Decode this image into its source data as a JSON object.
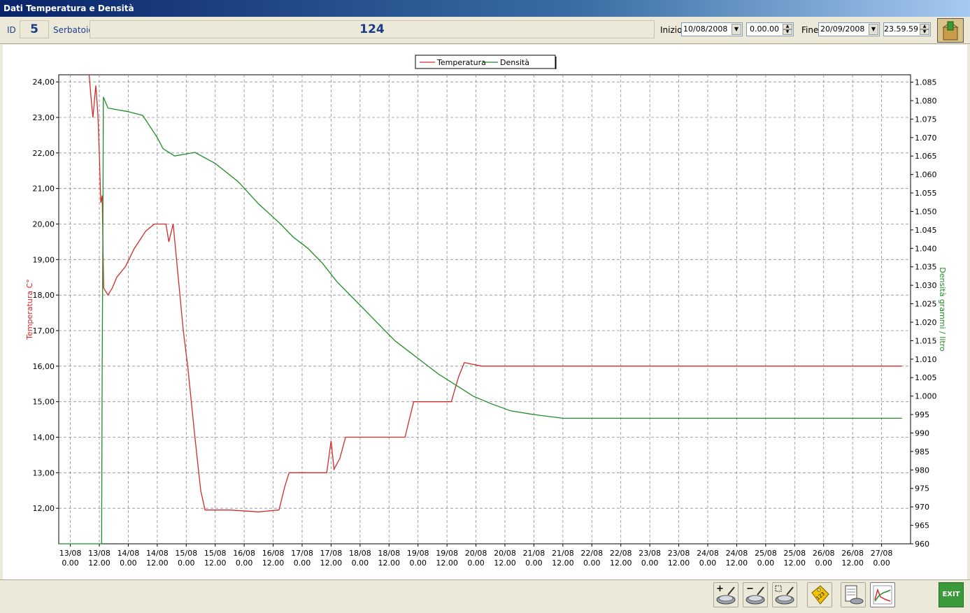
{
  "window": {
    "title": "Dati Temperatura e Densità"
  },
  "header": {
    "id_label": "ID",
    "id_value": "5",
    "tank_label": "Serbatoio",
    "tank_value": "124",
    "start_label": "Inizio",
    "start_date": "10/08/2008",
    "start_time": "0.00.00",
    "end_label": "Fine",
    "end_date": "20/09/2008",
    "end_time": "23.59.59"
  },
  "toolbar_icons": [
    "export-icon"
  ],
  "bottom_buttons": [
    {
      "name": "zoom-in-button",
      "icon": "zoom-in-icon"
    },
    {
      "name": "zoom-out-button",
      "icon": "zoom-out-icon"
    },
    {
      "name": "zoom-reset-button",
      "icon": "zoom-reset-icon"
    },
    {
      "name": "labels-button",
      "icon": "tag-icon"
    },
    {
      "name": "print-button",
      "icon": "print-icon"
    },
    {
      "name": "chart-button",
      "icon": "chart-icon"
    }
  ],
  "exit_label": "EXIT",
  "colors": {
    "temperature": "#d42a2a",
    "density": "#1e8c28",
    "grid": "#8c8c8c",
    "accent": "#1c3a8c"
  },
  "chart_data": {
    "type": "line",
    "title": "",
    "legend": [
      "Temperatura",
      "Densità"
    ],
    "legend_position": "top-center",
    "grid": true,
    "x_ticks": [
      {
        "date": "13/08",
        "time": "0.00"
      },
      {
        "date": "13/08",
        "time": "12.00"
      },
      {
        "date": "14/08",
        "time": "0.00"
      },
      {
        "date": "14/08",
        "time": "12.00"
      },
      {
        "date": "15/08",
        "time": "0.00"
      },
      {
        "date": "15/08",
        "time": "12.00"
      },
      {
        "date": "16/08",
        "time": "0.00"
      },
      {
        "date": "16/08",
        "time": "12.00"
      },
      {
        "date": "17/08",
        "time": "0.00"
      },
      {
        "date": "17/08",
        "time": "12.00"
      },
      {
        "date": "18/08",
        "time": "0.00"
      },
      {
        "date": "18/08",
        "time": "12.00"
      },
      {
        "date": "19/08",
        "time": "0.00"
      },
      {
        "date": "19/08",
        "time": "12.00"
      },
      {
        "date": "20/08",
        "time": "0.00"
      },
      {
        "date": "20/08",
        "time": "12.00"
      },
      {
        "date": "21/08",
        "time": "0.00"
      },
      {
        "date": "21/08",
        "time": "12.00"
      },
      {
        "date": "22/08",
        "time": "0.00"
      },
      {
        "date": "22/08",
        "time": "12.00"
      },
      {
        "date": "23/08",
        "time": "0.00"
      },
      {
        "date": "23/08",
        "time": "12.00"
      },
      {
        "date": "24/08",
        "time": "0.00"
      },
      {
        "date": "24/08",
        "time": "12.00"
      },
      {
        "date": "25/08",
        "time": "0.00"
      },
      {
        "date": "25/08",
        "time": "12.00"
      },
      {
        "date": "26/08",
        "time": "0.00"
      },
      {
        "date": "26/08",
        "time": "12.00"
      },
      {
        "date": "27/08",
        "time": "0.00"
      }
    ],
    "xlim": [
      -0.4,
      29.0
    ],
    "y_left": {
      "label": "Temperatura C°",
      "lim": [
        11.0,
        24.2
      ],
      "ticks": [
        "12,00",
        "13,00",
        "14,00",
        "15,00",
        "16,00",
        "17,00",
        "18,00",
        "19,00",
        "20,00",
        "21,00",
        "22,00",
        "23,00",
        "24,00"
      ]
    },
    "y_right": {
      "label": "Densità grammi / litro",
      "lim": [
        960,
        1087
      ],
      "ticks": [
        "960",
        "965",
        "970",
        "975",
        "980",
        "985",
        "990",
        "995",
        "1.000",
        "1.005",
        "1.010",
        "1.015",
        "1.020",
        "1.025",
        "1.030",
        "1.035",
        "1.040",
        "1.045",
        "1.050",
        "1.055",
        "1.060",
        "1.065",
        "1.070",
        "1.075",
        "1.080",
        "1.085"
      ]
    },
    "series": [
      {
        "name": "Temperatura",
        "axis": "left",
        "points": [
          [
            0.65,
            24.2
          ],
          [
            0.72,
            23.5
          ],
          [
            0.78,
            23.0
          ],
          [
            0.88,
            23.9
          ],
          [
            0.95,
            23.1
          ],
          [
            1.0,
            22.0
          ],
          [
            1.05,
            20.6
          ],
          [
            1.1,
            20.8
          ],
          [
            1.15,
            18.2
          ],
          [
            1.3,
            18.0
          ],
          [
            1.45,
            18.2
          ],
          [
            1.6,
            18.5
          ],
          [
            1.9,
            18.8
          ],
          [
            2.2,
            19.3
          ],
          [
            2.6,
            19.8
          ],
          [
            2.9,
            20.0
          ],
          [
            3.3,
            20.0
          ],
          [
            3.4,
            19.5
          ],
          [
            3.55,
            20.0
          ],
          [
            3.9,
            17.0
          ],
          [
            4.05,
            16.0
          ],
          [
            4.3,
            14.0
          ],
          [
            4.5,
            12.5
          ],
          [
            4.65,
            11.95
          ],
          [
            5.5,
            11.95
          ],
          [
            6.5,
            11.9
          ],
          [
            7.2,
            11.95
          ],
          [
            7.4,
            12.6
          ],
          [
            7.55,
            13.0
          ],
          [
            8.5,
            13.0
          ],
          [
            8.85,
            13.0
          ],
          [
            9.0,
            13.9
          ],
          [
            9.1,
            13.1
          ],
          [
            9.3,
            13.4
          ],
          [
            9.5,
            14.0
          ],
          [
            10.5,
            14.0
          ],
          [
            11.55,
            14.0
          ],
          [
            11.85,
            15.0
          ],
          [
            12.5,
            15.0
          ],
          [
            13.15,
            15.0
          ],
          [
            13.4,
            15.7
          ],
          [
            13.6,
            16.1
          ],
          [
            14.2,
            16.0
          ],
          [
            15.0,
            16.0
          ],
          [
            16.5,
            16.0
          ],
          [
            18.0,
            16.0
          ],
          [
            20.0,
            16.0
          ],
          [
            22.0,
            16.0
          ],
          [
            24.0,
            16.0
          ],
          [
            26.0,
            16.0
          ],
          [
            28.7,
            16.0
          ]
        ]
      },
      {
        "name": "Densità",
        "axis": "right",
        "points": [
          [
            -0.4,
            960
          ],
          [
            1.08,
            960
          ],
          [
            1.1,
            1007
          ],
          [
            1.12,
            1040
          ],
          [
            1.14,
            1081
          ],
          [
            1.3,
            1078
          ],
          [
            2.0,
            1077
          ],
          [
            2.5,
            1076
          ],
          [
            3.0,
            1070
          ],
          [
            3.2,
            1067
          ],
          [
            3.6,
            1065
          ],
          [
            4.3,
            1066
          ],
          [
            5.0,
            1063
          ],
          [
            5.8,
            1058
          ],
          [
            6.5,
            1052
          ],
          [
            7.2,
            1047
          ],
          [
            7.7,
            1043
          ],
          [
            8.2,
            1040
          ],
          [
            8.7,
            1036
          ],
          [
            9.2,
            1031
          ],
          [
            9.7,
            1027
          ],
          [
            10.2,
            1023
          ],
          [
            10.7,
            1019
          ],
          [
            11.2,
            1015
          ],
          [
            11.7,
            1012
          ],
          [
            12.2,
            1009
          ],
          [
            12.7,
            1006
          ],
          [
            13.1,
            1004
          ],
          [
            13.5,
            1002
          ],
          [
            13.9,
            1000
          ],
          [
            14.5,
            998
          ],
          [
            15.2,
            996
          ],
          [
            16.0,
            995
          ],
          [
            17.0,
            994
          ],
          [
            18.0,
            994
          ],
          [
            19.0,
            994
          ],
          [
            20.0,
            994
          ],
          [
            21.0,
            994
          ],
          [
            22.0,
            994
          ],
          [
            23.0,
            994
          ],
          [
            24.0,
            994
          ],
          [
            25.0,
            994
          ],
          [
            26.0,
            994
          ],
          [
            27.0,
            994
          ],
          [
            28.0,
            994
          ],
          [
            28.7,
            994
          ]
        ]
      }
    ]
  }
}
